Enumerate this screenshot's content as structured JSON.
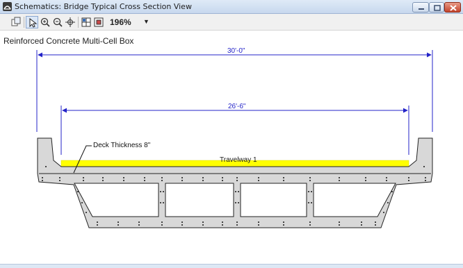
{
  "window": {
    "title": "Schematics: Bridge Typical Cross Section View",
    "app_icon": "bridge-app-icon",
    "controls": [
      "minimize-icon",
      "maximize-icon",
      "close-icon"
    ]
  },
  "toolbar": {
    "buttons": [
      {
        "name": "copy-icon",
        "active": false
      },
      {
        "name": "select-pointer-icon",
        "active": true
      },
      {
        "name": "zoom-in-icon",
        "active": false
      },
      {
        "name": "zoom-out-icon",
        "active": false
      },
      {
        "name": "pan-icon",
        "active": false
      },
      {
        "name": "zoom-extents-icon",
        "active": false
      },
      {
        "name": "zoom-window-icon",
        "active": false
      },
      {
        "name": "measure-icon",
        "active": false
      }
    ],
    "zoom_value": "196%"
  },
  "drawing": {
    "heading": "Reinforced Concrete Multi-Cell Box",
    "overall_width_label": "30'-0\"",
    "clear_width_label": "26'-6\"",
    "deck_thickness_label": "Deck Thickness 8\"",
    "travelway_label": "Travelway 1",
    "colors": {
      "dimension": "#2323c8",
      "travelway": "#ffff00",
      "concrete": "#d8d8d8",
      "outline": "#222222"
    }
  }
}
